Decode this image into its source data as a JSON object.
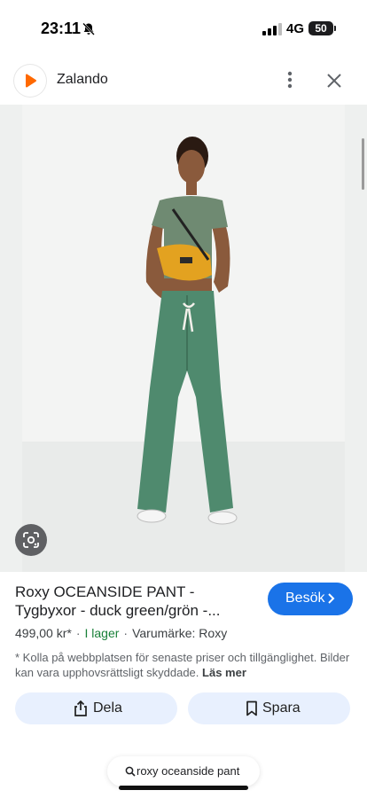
{
  "status_bar": {
    "time": "23:11",
    "network": "4G",
    "battery": "50"
  },
  "header": {
    "site_name": "Zalando",
    "brand_color": "#ff6900"
  },
  "product": {
    "title_line1": "Roxy OCEANSIDE PANT -",
    "title_line2": "Tygbyxor - duck green/grön -...",
    "price": "499,00 kr*",
    "stock": "I lager",
    "brand": "Varumärke: Roxy",
    "separator": "·"
  },
  "visit_button": {
    "label": "Besök"
  },
  "disclaimer": {
    "text": "* Kolla på webbplatsen för senaste priser och tillgänglighet. Bilder kan vara upphovsrättsligt skyddade.",
    "more_label": "Läs mer"
  },
  "actions": {
    "share_label": "Dela",
    "save_label": "Spara"
  },
  "search": {
    "query": "roxy oceanside pant"
  },
  "colors": {
    "accent": "#1a73e8",
    "button_bg": "#e8f0fe",
    "stock_green": "#188038",
    "pants": "#4f8a6e",
    "top": "#6f8a72",
    "bag": "#e3a220"
  },
  "icons": [
    "bell-slash-icon",
    "signal-icon",
    "more-vert-icon",
    "close-icon",
    "lens-icon",
    "chevron-right-icon",
    "share-icon",
    "bookmark-icon",
    "search-icon"
  ]
}
